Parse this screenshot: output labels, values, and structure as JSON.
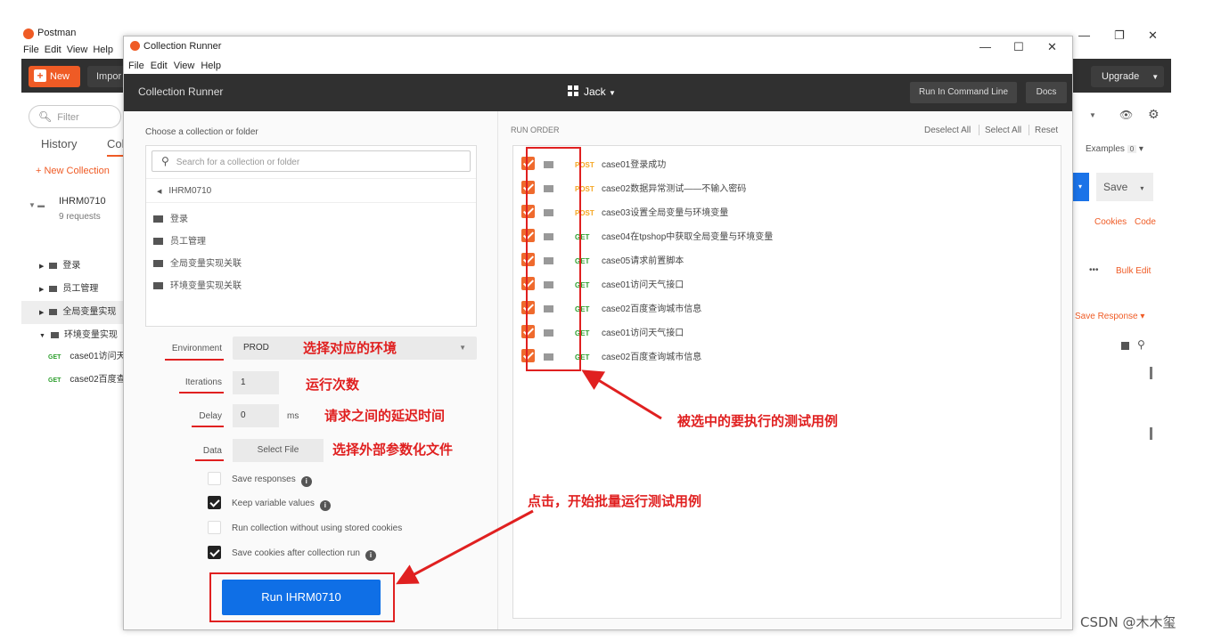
{
  "postman": {
    "title": "Postman",
    "menu": [
      "File",
      "Edit",
      "View",
      "Help"
    ],
    "new_label": "New",
    "import_label": "Impor",
    "upgrade_label": "Upgrade",
    "filter_placeholder": "Filter",
    "tab_history": "History",
    "tab_collections": "Col",
    "new_collection": "+ New Collection",
    "collection_name": "IHRM0710",
    "collection_sub": "9 requests",
    "folders": [
      "登录",
      "员工管理",
      "全局变量实现",
      "环境变量实现"
    ],
    "requests": [
      {
        "method": "GET",
        "name": "case01访问天"
      },
      {
        "method": "GET",
        "name": "case02百度查"
      }
    ],
    "examples_label": "Examples",
    "examples_count": "0",
    "save_label": "Save",
    "cookies_label": "Cookies",
    "code_label": "Code",
    "bulk_edit_label": "Bulk Edit",
    "save_response_label": "Save Response"
  },
  "runner": {
    "window_title": "Collection Runner",
    "menu": [
      "File",
      "Edit",
      "View",
      "Help"
    ],
    "header_title": "Collection Runner",
    "workspace": "Jack",
    "cmdline_label": "Run In Command Line",
    "docs_label": "Docs",
    "choose_label": "Choose a collection or folder",
    "search_placeholder": "Search for a collection or folder",
    "crumb": "IHRM0710",
    "picker_folders": [
      "登录",
      "员工管理",
      "全局变量实现关联",
      "环境变量实现关联"
    ],
    "env_label": "Environment",
    "env_value": "PROD",
    "iter_label": "Iterations",
    "iter_value": "1",
    "delay_label": "Delay",
    "delay_value": "0",
    "delay_unit": "ms",
    "data_label": "Data",
    "select_file": "Select File",
    "options": [
      {
        "label": "Save responses",
        "checked": false,
        "info": true
      },
      {
        "label": "Keep variable values",
        "checked": true,
        "info": true
      },
      {
        "label": "Run collection without using stored cookies",
        "checked": false,
        "info": false
      },
      {
        "label": "Save cookies after collection run",
        "checked": true,
        "info": true
      }
    ],
    "run_label": "Run IHRM0710",
    "run_order_label": "RUN ORDER",
    "deselect_all": "Deselect All",
    "select_all": "Select All",
    "reset": "Reset",
    "run_items": [
      {
        "method": "POST",
        "name": "case01登录成功"
      },
      {
        "method": "POST",
        "name": "case02数据异常测试——不输入密码"
      },
      {
        "method": "POST",
        "name": "case03设置全局变量与环境变量"
      },
      {
        "method": "GET",
        "name": "case04在tpshop中获取全局变量与环境变量"
      },
      {
        "method": "GET",
        "name": "case05请求前置脚本"
      },
      {
        "method": "GET",
        "name": "case01访问天气接口"
      },
      {
        "method": "GET",
        "name": "case02百度查询城市信息"
      },
      {
        "method": "GET",
        "name": "case01访问天气接口"
      },
      {
        "method": "GET",
        "name": "case02百度查询城市信息"
      }
    ]
  },
  "annotations": {
    "env": "选择对应的环境",
    "iter": "运行次数",
    "delay": "请求之间的延迟时间",
    "data": "选择外部参数化文件",
    "selected": "被选中的要执行的测试用例",
    "run": "点击，开始批量运行测试用例"
  },
  "watermark": "CSDN @木木玺",
  "colors": {
    "accent": "#ef5b25",
    "run_button": "#0f6fe6",
    "annotation": "#e02020",
    "get": "#2c9e2c",
    "post": "#f5a623"
  }
}
